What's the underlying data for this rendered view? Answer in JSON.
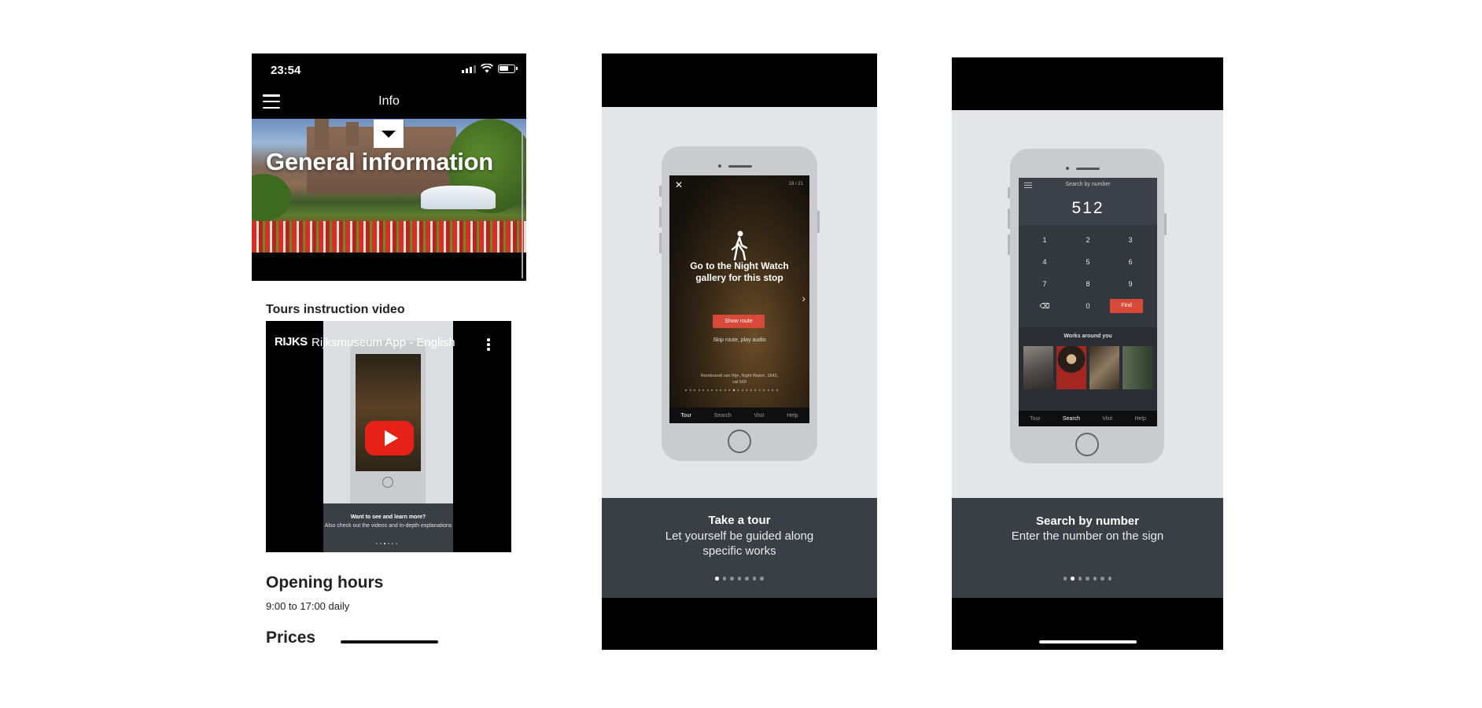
{
  "screen1": {
    "status_time": "23:54",
    "nav_title": "Info",
    "hero_title": "General information",
    "video_section_title": "Tours instruction video",
    "video": {
      "logo": "RIJKS",
      "title": "Rijksmuseum App - English",
      "inner_caption_title": "Want to see and learn more?",
      "inner_caption_text": "Also check out the videos and in-depth explanations"
    },
    "hours_title": "Opening hours",
    "hours_text": "9:00 to 17:00 daily",
    "prices_title": "Prices"
  },
  "screen2": {
    "close_glyph": "✕",
    "stop_counter": "18 / 21",
    "stop_text": "Go to the Night Watch gallery for this stop",
    "show_route_label": "Show route",
    "skip_text": "Skip route, play audio",
    "credit_text": "Rembrandt van Rijn, Night Watch, 1642, cat 500",
    "tabs": [
      "Tour",
      "Search",
      "Visit",
      "Help"
    ],
    "caption_title": "Take a tour",
    "caption_text": "Let yourself be guided along specific works",
    "active_dot_index": 0
  },
  "screen3": {
    "header_label": "Search by number",
    "entered_number": "512",
    "keys": [
      "1",
      "2",
      "3",
      "4",
      "5",
      "6",
      "7",
      "8",
      "9",
      "⌫",
      "0"
    ],
    "find_label": "Find",
    "works_label": "Works around you",
    "tabs": [
      "Tour",
      "Search",
      "Visit",
      "Help"
    ],
    "caption_title": "Search by number",
    "caption_text": "Enter the number on the sign",
    "active_dot_index": 1
  },
  "colors": {
    "accent_red": "#d9493a",
    "youtube_red": "#e62117",
    "caption_bg": "#3a3e45",
    "onboarding_bg": "#e4e5e7"
  }
}
